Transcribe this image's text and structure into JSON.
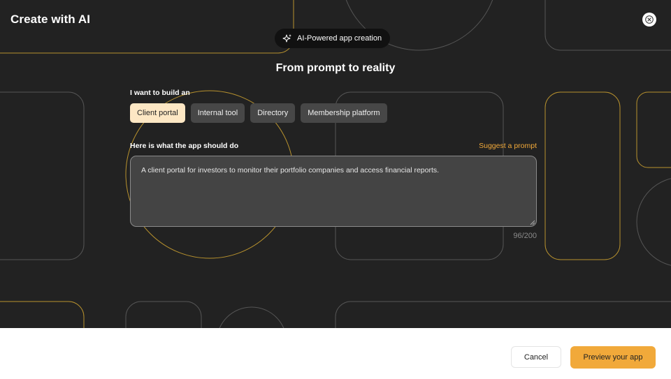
{
  "modal": {
    "title": "Create with AI",
    "badge": "AI-Powered app creation",
    "heading": "From prompt to reality"
  },
  "build": {
    "label": "I want to build an",
    "options": [
      {
        "label": "Client portal",
        "selected": true
      },
      {
        "label": "Internal tool",
        "selected": false
      },
      {
        "label": "Directory",
        "selected": false
      },
      {
        "label": "Membership platform",
        "selected": false
      }
    ]
  },
  "description": {
    "label": "Here is what the app should do",
    "suggest_label": "Suggest a prompt",
    "value": "A client portal for investors to monitor their portfolio companies and access financial reports.",
    "counter": "96/200"
  },
  "footer": {
    "cancel_label": "Cancel",
    "preview_label": "Preview your app"
  },
  "colors": {
    "accent": "#f1a93a",
    "selected_chip": "#fde7c4",
    "background": "#222222"
  },
  "icons": {
    "close": "close-icon",
    "badge": "sparkle-icon"
  }
}
